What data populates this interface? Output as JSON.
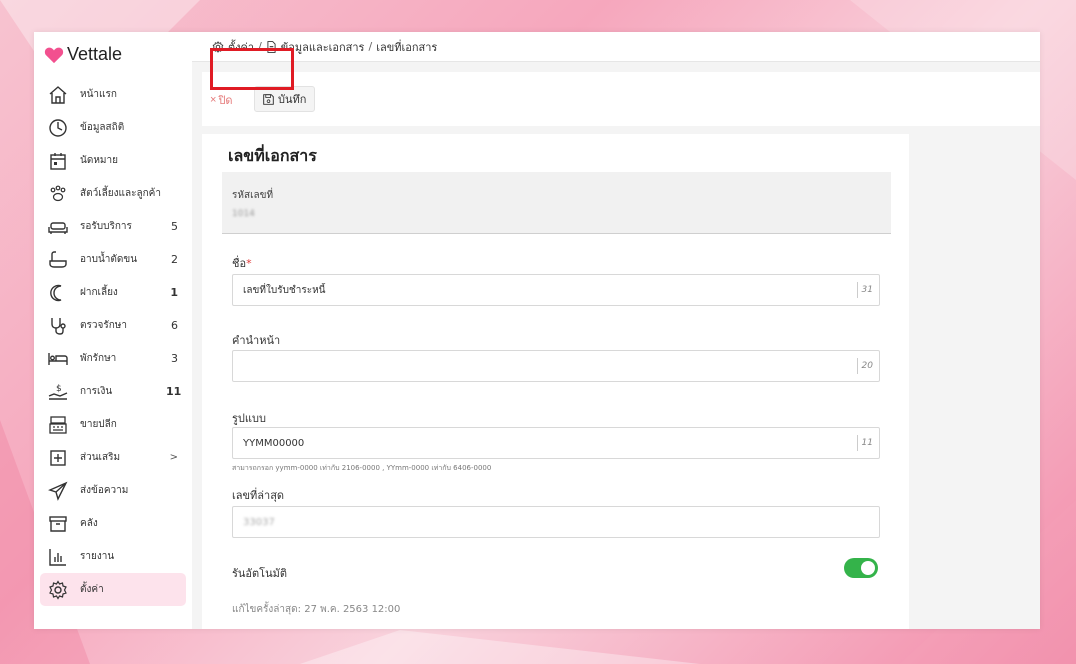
{
  "app": {
    "name": "Vettale"
  },
  "breadcrumb": {
    "items": [
      "ตั้งค่า",
      "ข้อมูลและเอกสาร",
      "เลขที่เอกสาร"
    ]
  },
  "sidebar": {
    "items": [
      {
        "label": "หน้าแรก",
        "icon": "home-icon",
        "badge": ""
      },
      {
        "label": "ข้อมูลสถิติ",
        "icon": "stats-icon",
        "badge": ""
      },
      {
        "label": "นัดหมาย",
        "icon": "calendar-icon",
        "badge": ""
      },
      {
        "label": "สัตว์เลี้ยงและลูกค้า",
        "icon": "paw-icon",
        "badge": ""
      },
      {
        "label": "รอรับบริการ",
        "icon": "sofa-icon",
        "badge": "5"
      },
      {
        "label": "อาบน้ำตัดขน",
        "icon": "bathtub-icon",
        "badge": "2"
      },
      {
        "label": "ฝากเลี้ยง",
        "icon": "moon-icon",
        "badge": "1"
      },
      {
        "label": "ตรวจรักษา",
        "icon": "stethoscope-icon",
        "badge": "6"
      },
      {
        "label": "พักรักษา",
        "icon": "bed-icon",
        "badge": "3"
      },
      {
        "label": "การเงิน",
        "icon": "money-icon",
        "badge": "11"
      },
      {
        "label": "ขายปลีก",
        "icon": "cash-register-icon",
        "badge": ""
      },
      {
        "label": "ส่วนเสริม",
        "icon": "plus-box-icon",
        "badge": ""
      },
      {
        "label": "ส่งข้อความ",
        "icon": "send-icon",
        "badge": ""
      },
      {
        "label": "คลัง",
        "icon": "archive-icon",
        "badge": ""
      },
      {
        "label": "รายงาน",
        "icon": "bar-chart-icon",
        "badge": ""
      },
      {
        "label": "ตั้งค่า",
        "icon": "gear-icon",
        "badge": ""
      }
    ],
    "chevron": ">"
  },
  "toolbar": {
    "close_label": "ปิด",
    "save_label": "บันทึก"
  },
  "form": {
    "title": "เลขที่เอกสาร",
    "code_label": "รหัสเลขที่",
    "code_value": "1014",
    "name_label": "ชื่อ",
    "name_required": "*",
    "name_value": "เลขที่ใบรับชำระหนี้",
    "name_counter": "31",
    "prefix_label": "คำนำหน้า",
    "prefix_value": "",
    "prefix_counter": "20",
    "format_label": "รูปแบบ",
    "format_value": "YYMM00000",
    "format_counter": "11",
    "format_hint": "สามารถกรอก yymm-0000 เท่ากับ 2106-0000 , YYmm-0000 เท่ากับ 6406-0000",
    "latest_label": "เลขที่ล่าสุด",
    "latest_value": "33037",
    "auto_label": "รันอัตโนมัติ",
    "auto_enabled": true,
    "last_edit_prefix": "แก้ไขครั้งล่าสุด:",
    "last_edit_value": "27 พ.ค. 2563 12:00"
  },
  "colors": {
    "accent_pink": "#f2508f",
    "toggle_on": "#34b34a",
    "highlight": "#e01b24",
    "close_red": "#e57a7a"
  }
}
